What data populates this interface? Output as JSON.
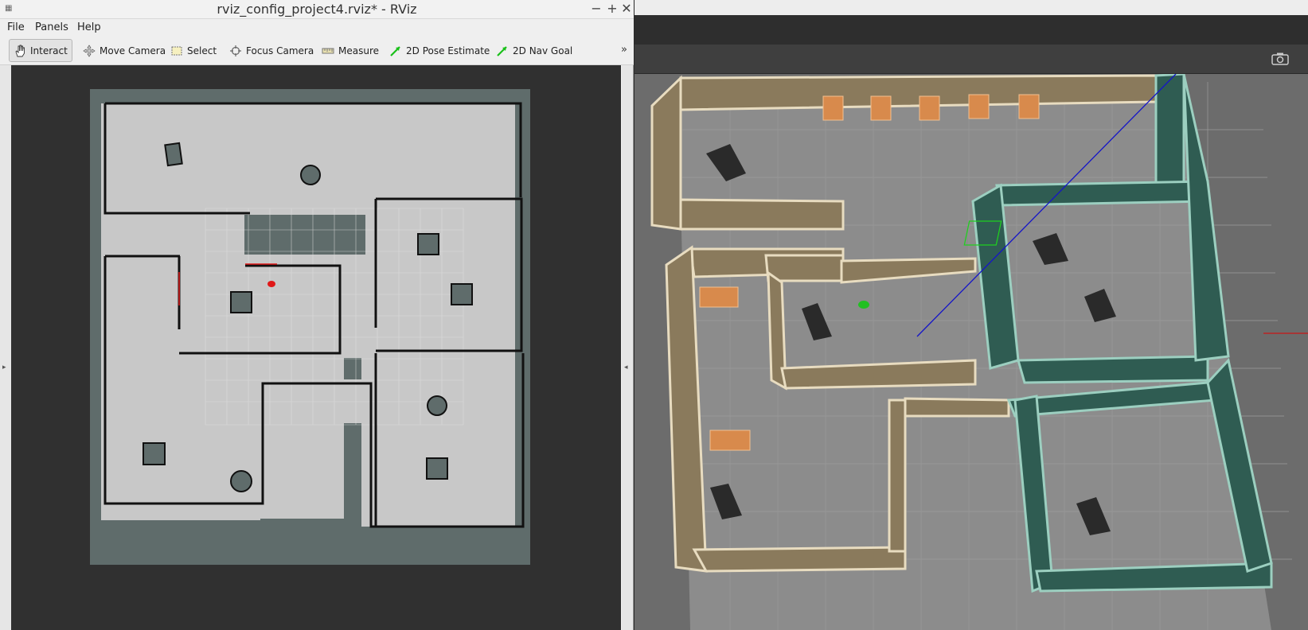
{
  "window": {
    "title": "rviz_config_project4.rviz* - RViz",
    "minimize_glyph": "−",
    "maximize_glyph": "+",
    "close_glyph": "✕"
  },
  "menu": [
    "File",
    "Panels",
    "Help"
  ],
  "toolbar": {
    "tools": [
      {
        "label": "Interact",
        "icon": "hand-icon",
        "active": true
      },
      {
        "label": "Move Camera",
        "icon": "move-camera-icon"
      },
      {
        "label": "Select",
        "icon": "select-icon"
      },
      {
        "label": "Focus Camera",
        "icon": "focus-camera-icon"
      },
      {
        "label": "Measure",
        "icon": "ruler-icon"
      },
      {
        "label": "2D Pose Estimate",
        "icon": "green-arrow-icon"
      },
      {
        "label": "2D Nav Goal",
        "icon": "green-arrow-icon"
      }
    ],
    "more": "»"
  },
  "side_handles": {
    "left": "▸",
    "right": "◂"
  },
  "colors": {
    "map_free": "#c8c8c8",
    "map_unknown": "#5f6c6b",
    "map_wall": "#111111",
    "robot_rviz": "#e01818",
    "robot_gazebo": "#22c022",
    "wall_tan": "#8a7a5c",
    "wall_green": "#2f5c52",
    "floor_gray": "#8c8c8c"
  }
}
